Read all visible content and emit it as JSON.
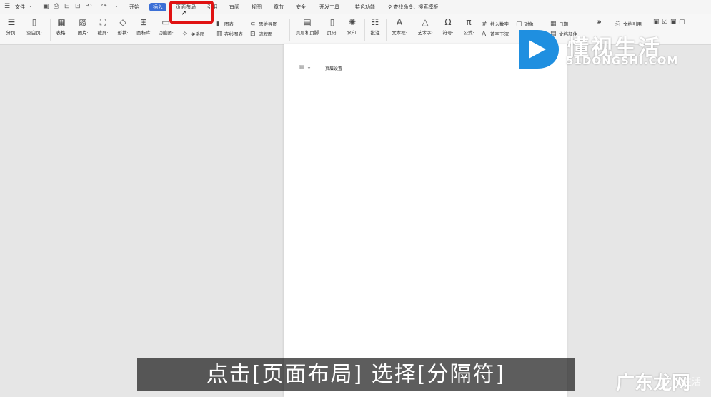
{
  "menubar": {
    "file_label": "文件",
    "tabs": [
      {
        "label": "开始"
      },
      {
        "label": "插入"
      },
      {
        "label": "页面布局"
      },
      {
        "label": "引用"
      },
      {
        "label": "审阅"
      },
      {
        "label": "视图"
      },
      {
        "label": "章节"
      },
      {
        "label": "安全"
      },
      {
        "label": "开发工具"
      },
      {
        "label": "特色功能"
      }
    ],
    "active_tab": "插入",
    "search_text": "查找命令、搜索模板"
  },
  "ribbon": {
    "tools": [
      {
        "label": "分页·",
        "icon": "page-break-icon"
      },
      {
        "label": "空白页·",
        "icon": "blank-page-icon"
      },
      {
        "label": "表格·",
        "icon": "table-icon"
      },
      {
        "label": "图片·",
        "icon": "picture-icon"
      },
      {
        "label": "截屏·",
        "icon": "screenshot-icon"
      },
      {
        "label": "形状·",
        "icon": "shape-icon"
      },
      {
        "label": "图标库",
        "icon": "icon-library-icon"
      },
      {
        "label": "功能图·",
        "icon": "function-chart-icon"
      },
      {
        "label": "页眉和页脚",
        "icon": "header-footer-icon"
      },
      {
        "label": "页码·",
        "icon": "page-number-icon"
      },
      {
        "label": "水印·",
        "icon": "watermark-icon"
      },
      {
        "label": "批注",
        "icon": "comment-icon"
      },
      {
        "label": "文本框·",
        "icon": "textbox-icon"
      },
      {
        "label": "艺术字·",
        "icon": "wordart-icon"
      },
      {
        "label": "符号·",
        "icon": "symbol-icon"
      },
      {
        "label": "公式·",
        "icon": "formula-icon"
      }
    ],
    "small_tools": [
      {
        "label": "关系图"
      },
      {
        "label": "图表"
      },
      {
        "label": "思维导图·"
      },
      {
        "label": "在线图表"
      },
      {
        "label": "流程图·"
      },
      {
        "label": "插入数字"
      },
      {
        "label": "首字下沉"
      },
      {
        "label": "对象·"
      },
      {
        "label": "日期"
      },
      {
        "label": "文档部件"
      },
      {
        "label": "文档引用"
      },
      {
        "label": "超链接"
      }
    ]
  },
  "document": {
    "header_text": "页眉设置"
  },
  "subtitle": "点击[页面布局] 选择[分隔符]",
  "logo": {
    "name": "懂视生活",
    "url": "51DONGSHI.COM"
  },
  "watermark": {
    "text": "广东龙网",
    "small": "生活"
  },
  "colors": {
    "accent": "#3b6fd6",
    "highlight": "#e01212",
    "logo_blue": "#1f8fe0"
  }
}
